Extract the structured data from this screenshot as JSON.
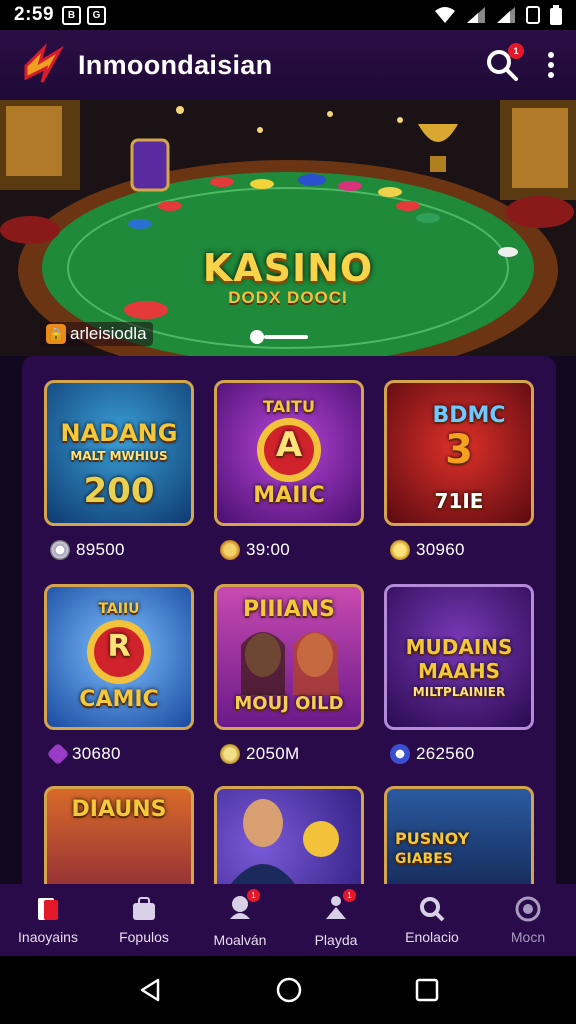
{
  "status_bar": {
    "time": "2:59",
    "notif_a": "B",
    "notif_b": "G"
  },
  "app_bar": {
    "title": "Inmoondaisian",
    "search_badge": "1"
  },
  "hero": {
    "title": "KASINO",
    "subtitle": "DODX DOOCI",
    "label": "arleisiodla"
  },
  "games": [
    {
      "title_top": "NADANG",
      "title_mid": "MALT MWHIUS",
      "title_bottom": "200",
      "value": "89500",
      "coin_color": "#c9c9d6",
      "bg": "#1b6ea8"
    },
    {
      "title_top": "TAITU",
      "title_mid": "A",
      "title_bottom": "MAIIC",
      "value": "39:00",
      "coin_color": "#e2a23a",
      "bg": "#6d1f9b"
    },
    {
      "title_top": "BDMC",
      "title_mid": "3",
      "title_bottom": "71IE",
      "value": "30960",
      "coin_color": "#e8c23a",
      "bg": "#a0151e"
    },
    {
      "title_top": "TAIIU",
      "title_mid": "R",
      "title_bottom": "CAMIC",
      "value": "30680",
      "coin_color": "#9b3cc9",
      "bg": "#2c6fc6"
    },
    {
      "title_top": "PIIIANS",
      "title_mid": "",
      "title_bottom": "MOUJ OILD",
      "value": "2050M",
      "coin_color": "#e7c85a",
      "bg": "#8a2aa6"
    },
    {
      "title_top": "MUDAINS",
      "title_mid": "MAAHS",
      "title_bottom": "MILTPLAINIER",
      "value": "262560",
      "coin_color": "#3d4fd1",
      "bg": "#4a1a78"
    },
    {
      "title_top": "DIAUNS",
      "title_mid": "",
      "title_bottom": "",
      "value": "",
      "coin_color": "",
      "bg": "#b24a1a"
    },
    {
      "title_top": "",
      "title_mid": "",
      "title_bottom": "",
      "value": "",
      "coin_color": "",
      "bg": "#3a2aa0"
    },
    {
      "title_top": "PUSNOY",
      "title_mid": "GIABES",
      "title_bottom": "",
      "value": "",
      "coin_color": "",
      "bg": "#1c3f78"
    }
  ],
  "bottom_nav": [
    {
      "label": "Inaoyains",
      "icon": "cards-icon",
      "badge": ""
    },
    {
      "label": "Fopulos",
      "icon": "bag-icon",
      "badge": ""
    },
    {
      "label": "Moalván",
      "icon": "chat-icon",
      "badge": "1"
    },
    {
      "label": "Playda",
      "icon": "player-icon",
      "badge": "1"
    },
    {
      "label": "Enolacio",
      "icon": "search-icon",
      "badge": ""
    },
    {
      "label": "Mocn",
      "icon": "circle-icon",
      "badge": ""
    }
  ]
}
